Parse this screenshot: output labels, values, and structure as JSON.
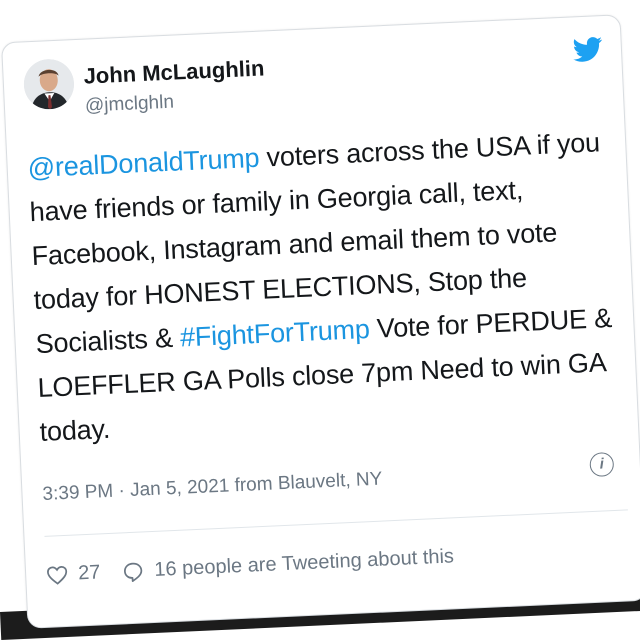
{
  "tweet": {
    "author_name": "John McLaughlin",
    "author_handle": "@jmclghln",
    "mention": "@realDonaldTrump",
    "text_part1": " voters across the USA if you have friends or family in Georgia call, text, Facebook, Instagram and email them to vote today for HONEST ELECTIONS, Stop the Socialists & ",
    "hashtag": "#FightForTrump",
    "text_part2": " Vote for PERDUE & LOEFFLER GA Polls close 7pm Need to win GA today.",
    "meta": "3:39 PM · Jan 5, 2021 from Blauvelt, NY",
    "like_count": "27",
    "reply_text": "16 people are Tweeting about this"
  },
  "icons": {
    "brand": "twitter-bird-icon",
    "info": "info-icon",
    "like": "heart-icon",
    "reply": "speech-bubble-icon"
  },
  "colors": {
    "link": "#1b95e0",
    "brand": "#1da1f2",
    "text": "#14171a",
    "muted": "#6b7783"
  }
}
